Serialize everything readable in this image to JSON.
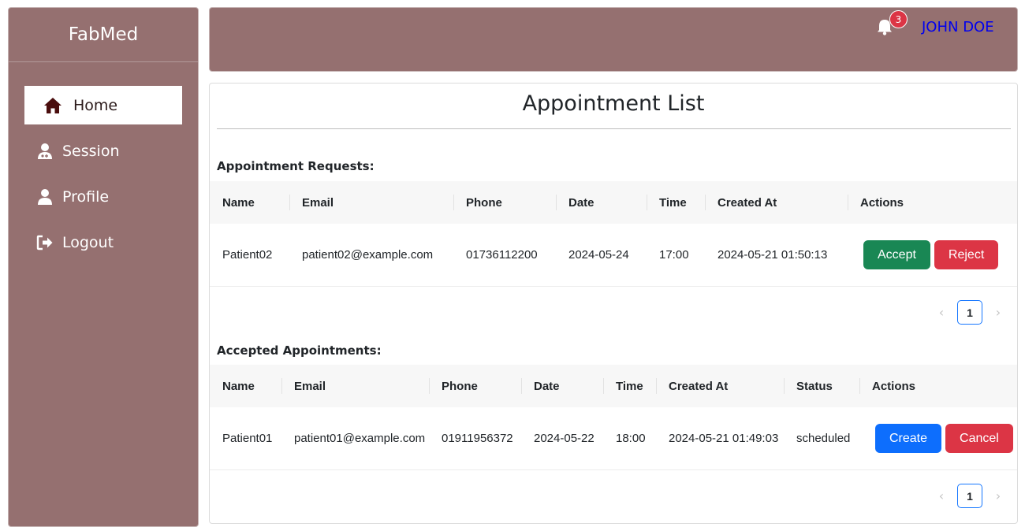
{
  "sidebar": {
    "brand": "FabMed",
    "items": [
      {
        "label": "Home",
        "icon": "home-icon"
      },
      {
        "label": "Session",
        "icon": "doctor-icon"
      },
      {
        "label": "Profile",
        "icon": "user-icon"
      },
      {
        "label": "Logout",
        "icon": "logout-icon"
      }
    ]
  },
  "header": {
    "notification_count": "3",
    "user_name": "JOHN DOE"
  },
  "main": {
    "title": "Appointment List",
    "requests": {
      "title": "Appointment Requests:",
      "columns": [
        "Name",
        "Email",
        "Phone",
        "Date",
        "Time",
        "Created At",
        "Actions"
      ],
      "rows": [
        {
          "name": "Patient02",
          "email": "patient02@example.com",
          "phone": "01736112200",
          "date": "2024-05-24",
          "time": "17:00",
          "created_at": "2024-05-21 01:50:13"
        }
      ],
      "accept_label": "Accept",
      "reject_label": "Reject",
      "page": "1"
    },
    "accepted": {
      "title": "Accepted Appointments:",
      "columns": [
        "Name",
        "Email",
        "Phone",
        "Date",
        "Time",
        "Created At",
        "Status",
        "Actions"
      ],
      "rows": [
        {
          "name": "Patient01",
          "email": "patient01@example.com",
          "phone": "01911956372",
          "date": "2024-05-22",
          "time": "18:00",
          "created_at": "2024-05-21 01:49:03",
          "status": "scheduled"
        }
      ],
      "create_label": "Create",
      "cancel_label": "Cancel",
      "page": "1"
    }
  },
  "colors": {
    "sidebar_bg": "#957070",
    "accept": "#198754",
    "reject": "#dc3545",
    "create": "#0d6efd",
    "user_link": "#0000ee"
  }
}
